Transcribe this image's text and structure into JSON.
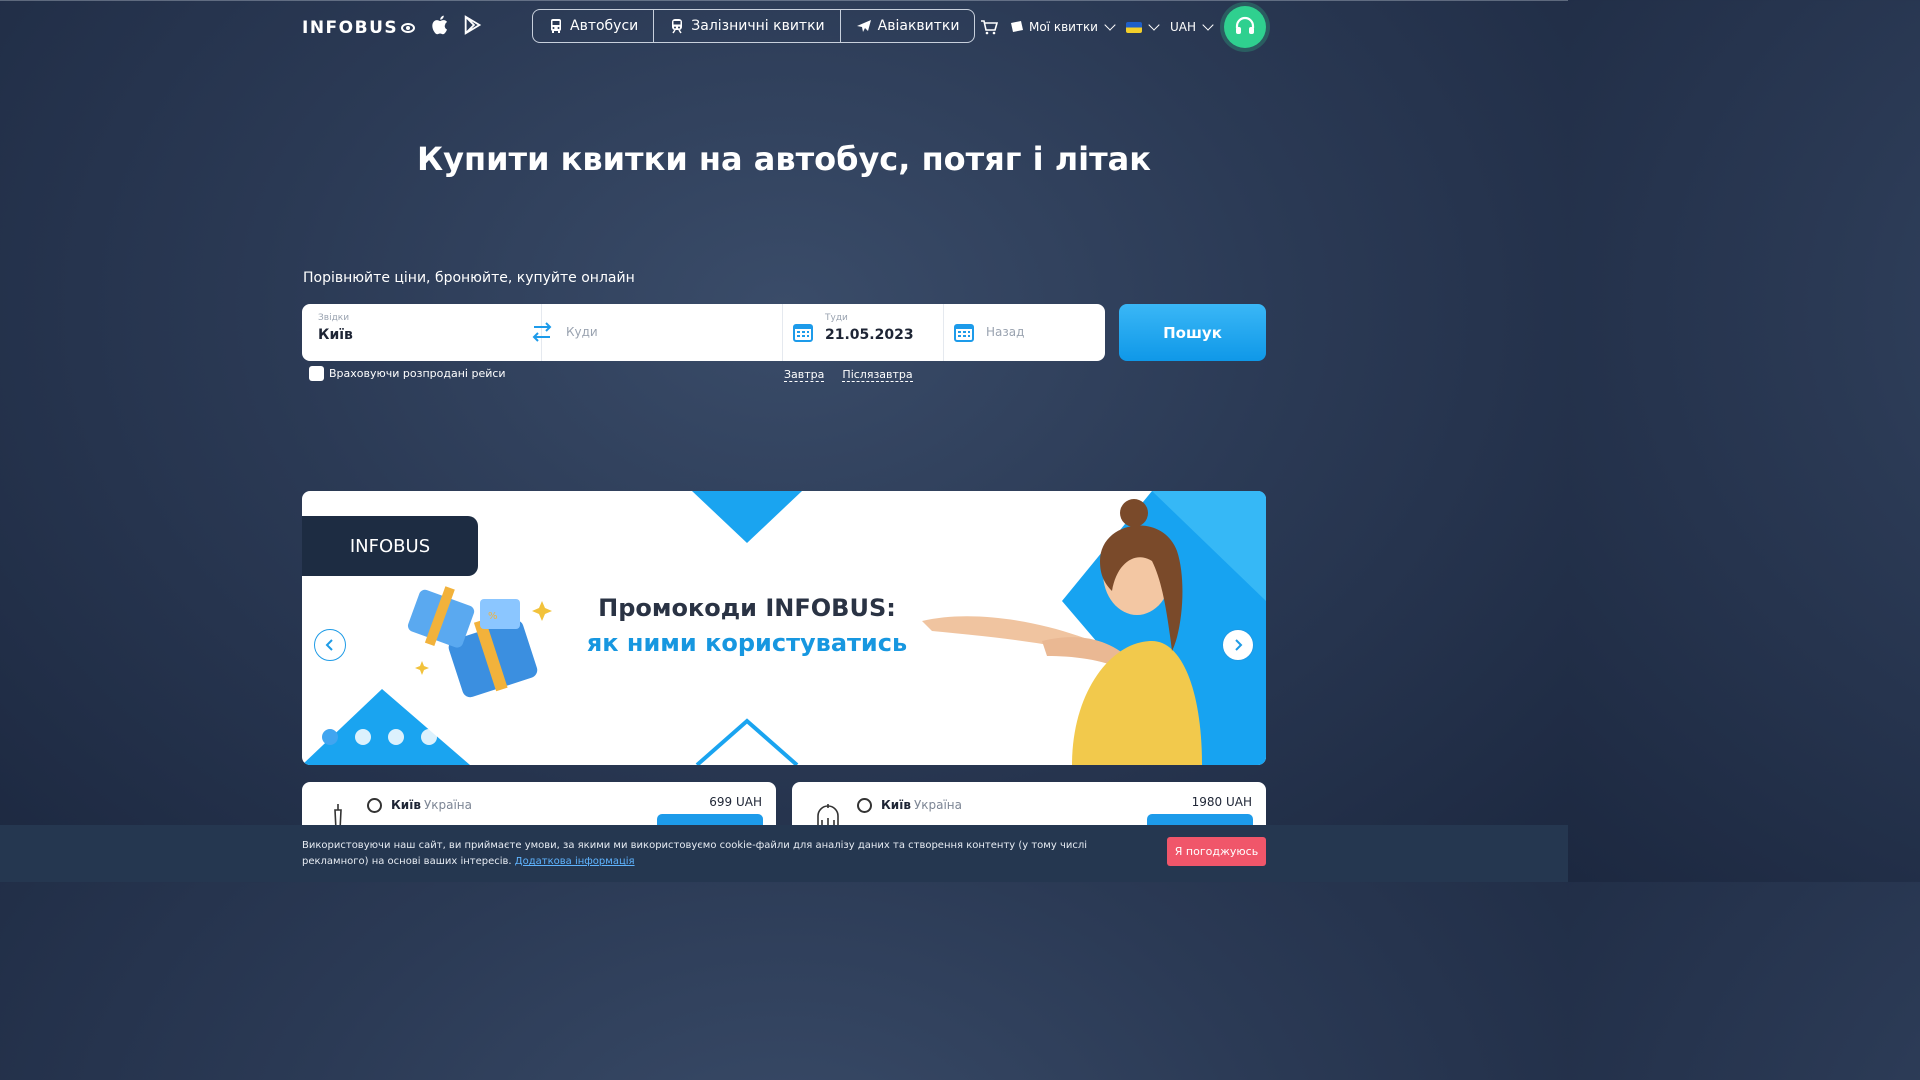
{
  "header": {
    "logo": "INFOBUS",
    "modes": [
      {
        "label": "Автобуси",
        "icon": "bus-icon"
      },
      {
        "label": "Залізничні квитки",
        "icon": "train-icon"
      },
      {
        "label": "Авіаквитки",
        "icon": "plane-icon"
      }
    ],
    "my_tickets": "Мої квитки",
    "currency": "UAH"
  },
  "hero": {
    "title": "Купити квитки на автобус, потяг і літак",
    "subtitle": "Порівнюйте ціни, бронюйте, купуйте онлайн"
  },
  "search": {
    "from_label": "Звідки",
    "from_value": "Київ",
    "to_placeholder": "Куди",
    "there_label": "Туди",
    "there_value": "21.05.2023",
    "back_placeholder": "Назад",
    "button": "Пошук",
    "sold_out_label": "Враховуючи розпродані рейси",
    "tomorrow": "Завтра",
    "day_after": "Післязавтра"
  },
  "banner": {
    "tag": "INFOBUS",
    "title_line1": "Промокоди INFOBUS:",
    "title_line2": "як ними користуватись",
    "slides": 4,
    "active_slide": 1
  },
  "routes": [
    {
      "city": "Київ",
      "country": "Україна",
      "price": "699 UAH"
    },
    {
      "city": "Київ",
      "country": "Україна",
      "price": "1980 UAH"
    }
  ],
  "cookie": {
    "text": "Використовуючи наш сайт, ви приймаєте умови, за якими ми використовуємо cookie-файли для аналізу даних та створення контенту (у тому числі рекламного) на основі ваших інтересів.",
    "link": "Додаткова інформація",
    "accept": "Я погоджуюсь"
  },
  "colors": {
    "accent": "#1d9bea",
    "support": "#2fd08f",
    "cookie_button": "#f0566a",
    "background": "#2b3a55"
  }
}
